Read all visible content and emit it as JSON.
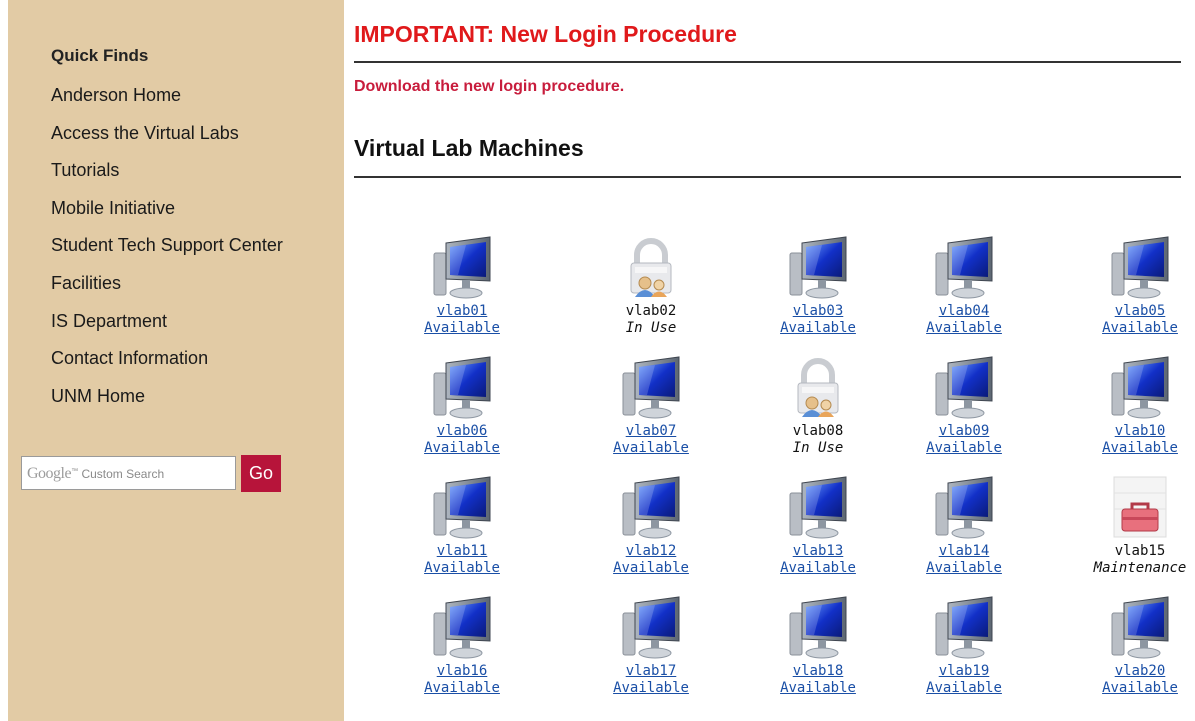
{
  "sidebar": {
    "title": "Quick Finds",
    "links": [
      "Anderson Home",
      "Access the Virtual Labs",
      "Tutorials",
      "Mobile Initiative",
      "Student Tech Support Center",
      "Facilities",
      "IS Department",
      "Contact Information",
      "UNM Home"
    ],
    "search": {
      "brand": "Google",
      "trademark": "™",
      "label": "Custom Search",
      "button": "Go"
    }
  },
  "main": {
    "heading": "IMPORTANT: New Login Procedure",
    "download_link": "Download the new login procedure.",
    "section_title": "Virtual Lab Machines"
  },
  "machines": [
    {
      "name": "vlab01",
      "status": "Available",
      "state": "available"
    },
    {
      "name": "vlab02",
      "status": "In Use",
      "state": "in-use"
    },
    {
      "name": "vlab03",
      "status": "Available",
      "state": "available"
    },
    {
      "name": "vlab04",
      "status": "Available",
      "state": "available"
    },
    {
      "name": "vlab05",
      "status": "Available",
      "state": "available"
    },
    {
      "name": "vlab06",
      "status": "Available",
      "state": "available"
    },
    {
      "name": "vlab07",
      "status": "Available",
      "state": "available"
    },
    {
      "name": "vlab08",
      "status": "In Use",
      "state": "in-use"
    },
    {
      "name": "vlab09",
      "status": "Available",
      "state": "available"
    },
    {
      "name": "vlab10",
      "status": "Available",
      "state": "available"
    },
    {
      "name": "vlab11",
      "status": "Available",
      "state": "available"
    },
    {
      "name": "vlab12",
      "status": "Available",
      "state": "available"
    },
    {
      "name": "vlab13",
      "status": "Available",
      "state": "available"
    },
    {
      "name": "vlab14",
      "status": "Available",
      "state": "available"
    },
    {
      "name": "vlab15",
      "status": "Maintenance",
      "state": "maintenance"
    },
    {
      "name": "vlab16",
      "status": "Available",
      "state": "available"
    },
    {
      "name": "vlab17",
      "status": "Available",
      "state": "available"
    },
    {
      "name": "vlab18",
      "status": "Available",
      "state": "available"
    },
    {
      "name": "vlab19",
      "status": "Available",
      "state": "available"
    },
    {
      "name": "vlab20",
      "status": "Available",
      "state": "available"
    }
  ],
  "colors": {
    "sidebar_bg": "#e2cba5",
    "important_red": "#e0191b",
    "download_red": "#c81c3c",
    "link_blue": "#1a4fa6",
    "go_button": "#b7143a"
  }
}
